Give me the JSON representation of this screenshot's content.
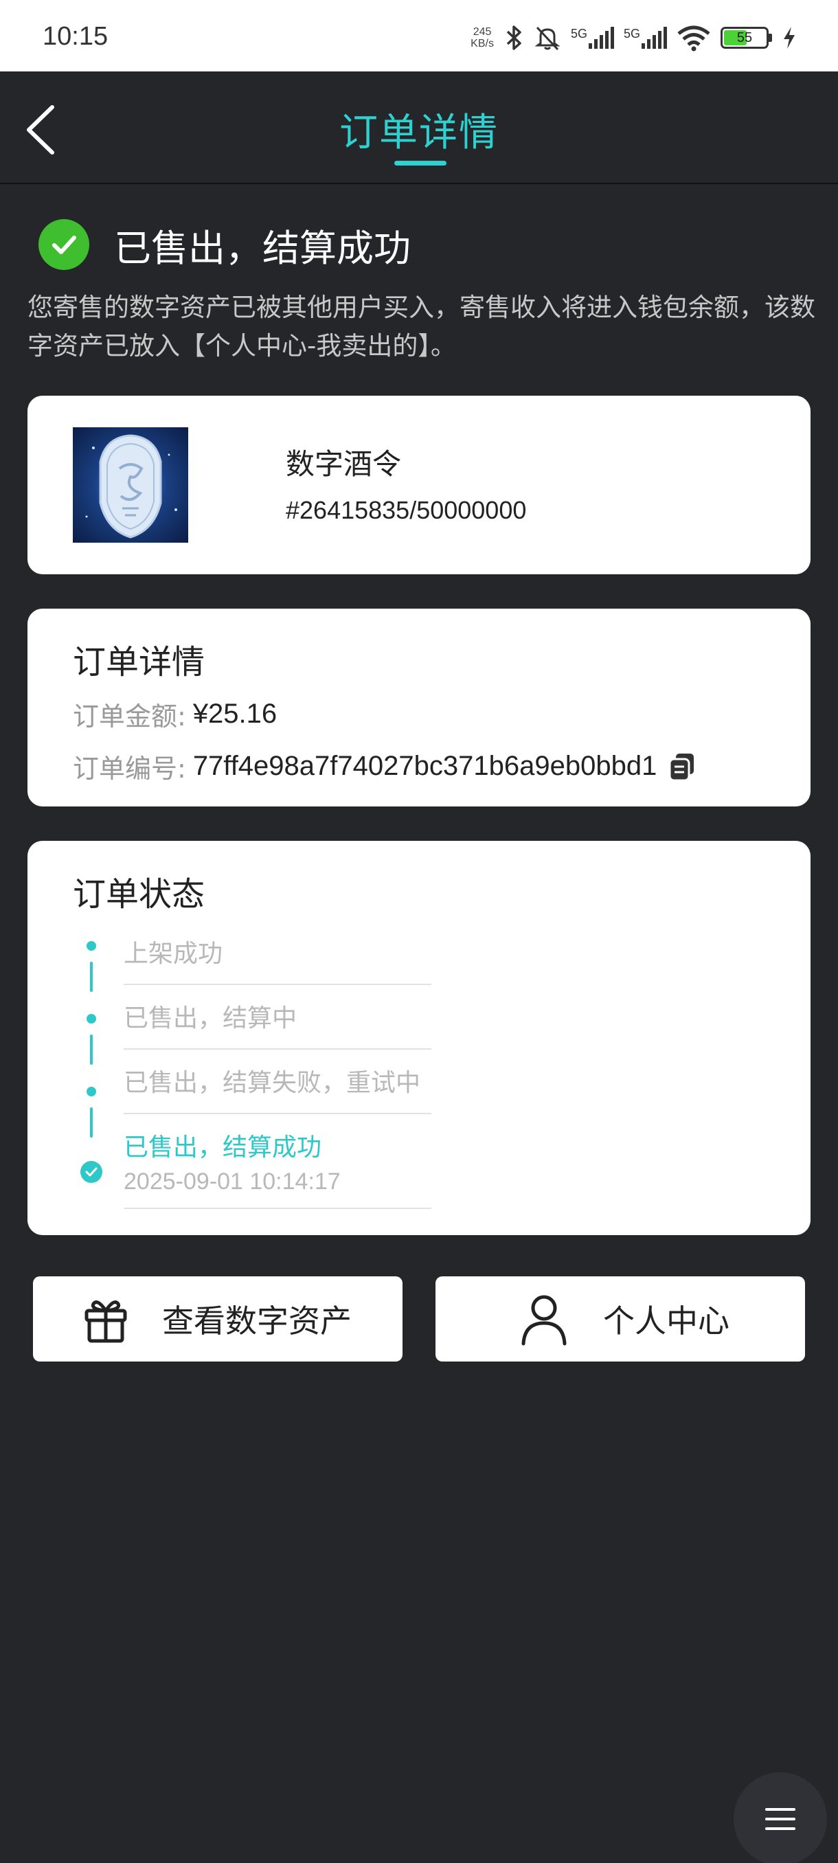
{
  "status_bar": {
    "time": "10:15",
    "net_speed_value": "245",
    "net_speed_unit": "KB/s",
    "sim1_label": "5G",
    "sim2_label": "5G",
    "battery_level": "55",
    "icons": [
      "bluetooth-icon",
      "mute-bell-icon",
      "signal-icon",
      "wifi-icon",
      "battery-icon",
      "charging-icon"
    ]
  },
  "header": {
    "title": "订单详情",
    "accent_color": "#2ed0d0"
  },
  "result": {
    "title": "已售出，结算成功",
    "description": "您寄售的数字资产已被其他用户买入，寄售收入将进入钱包余额，该数字资产已放入【个人中心-我卖出的】。",
    "success_color": "#3fbf2f"
  },
  "asset": {
    "name": "数字酒令",
    "serial": "#26415835/50000000"
  },
  "order": {
    "heading": "订单详情",
    "amount_label": "订单金额:",
    "amount_value": "¥25.16",
    "number_label": "订单编号:",
    "number_value": "77ff4e98a7f74027bc371b6a9eb0bbd1"
  },
  "status": {
    "heading": "订单状态",
    "steps": [
      {
        "label": "上架成功"
      },
      {
        "label": "已售出，结算中"
      },
      {
        "label": "已售出，结算失败，重试中"
      },
      {
        "label": "已售出，结算成功",
        "time": "2025-09-01 10:14:17"
      }
    ]
  },
  "actions": {
    "view_assets_label": "查看数字资产",
    "profile_label": "个人中心"
  }
}
